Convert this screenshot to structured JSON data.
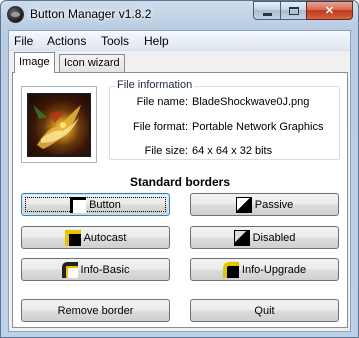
{
  "window": {
    "title": "Button Manager v1.8.2",
    "controls": {
      "minimize_icon": "minimize-icon",
      "maximize_icon": "maximize-icon",
      "close_icon": "close-icon"
    }
  },
  "menu": {
    "items": [
      "File",
      "Actions",
      "Tools",
      "Help"
    ]
  },
  "tabs": [
    {
      "label": "Image",
      "active": true
    },
    {
      "label": "Icon wizard",
      "active": false
    }
  ],
  "file_info": {
    "group_title": "File information",
    "rows": [
      {
        "label": "File name:",
        "value": "BladeShockwave0J.png"
      },
      {
        "label": "File format:",
        "value": "Portable Network Graphics"
      },
      {
        "label": "File size:",
        "value": "64 x 64 x 32 bits"
      }
    ]
  },
  "borders": {
    "title": "Standard borders",
    "buttons": [
      {
        "label": "Button",
        "icon": "button-border-icon"
      },
      {
        "label": "Passive",
        "icon": "passive-border-icon"
      },
      {
        "label": "Autocast",
        "icon": "autocast-border-icon"
      },
      {
        "label": "Disabled",
        "icon": "disabled-border-icon"
      },
      {
        "label": "Info-Basic",
        "icon": "info-basic-border-icon"
      },
      {
        "label": "Info-Upgrade",
        "icon": "info-upgrade-border-icon"
      }
    ]
  },
  "actions": {
    "remove_border": "Remove border",
    "quit": "Quit"
  },
  "colors": {
    "title_gradient_top": "#cfdcec",
    "close_button": "#c0391e",
    "focus_border": "#3c7fb1",
    "panel_bg": "#ffffff"
  }
}
